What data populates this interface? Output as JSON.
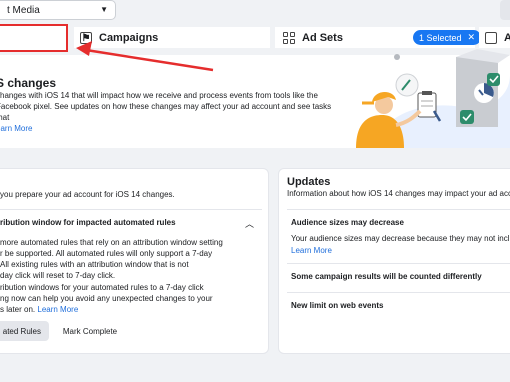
{
  "header": {
    "account_select_value": "t Media"
  },
  "tabs": {
    "campaigns_label": "Campaigns",
    "adsets_label": "Ad Sets",
    "adsets_badge": "1 Selected",
    "ads_label": "Ac"
  },
  "banner": {
    "title": "S changes",
    "body_line1": "changes with iOS 14 that will impact how we receive and process events from tools like the",
    "body_line2": "Facebook pixel. See updates on how these changes may affect your ad account and see tasks that",
    "learn_more": "earn More"
  },
  "tasks_card": {
    "intro": "you prepare your ad account for iOS 14 changes.",
    "heading": "ribution window for impacted automated rules",
    "p1_lines": [
      "more automated rules that rely on an attribution window setting",
      "r be supported. All automated rules will only support a 7-day",
      "All existing rules with an attribution window that is not",
      "day click will reset to 7-day click."
    ],
    "p2_lines": [
      "ribution windows for your automated rules to a 7-day click",
      "ng now can help you avoid any unexpected changes to your",
      "s later on."
    ],
    "p2_learn_more": "Learn More",
    "automated_rules_button": "ated Rules",
    "mark_complete_button": "Mark Complete"
  },
  "updates_card": {
    "title": "Updates",
    "subtitle": "Information about how iOS 14 changes may impact your ad accou",
    "items": [
      {
        "title": "Audience sizes may decrease",
        "body": "Your audience sizes may decrease because they may not includ",
        "link": "Learn More"
      },
      {
        "title": "Some campaign results will be counted differently"
      },
      {
        "title": "New limit on web events"
      }
    ]
  },
  "colors": {
    "accent_blue": "#1877f2",
    "annotation_red": "#e52d2d",
    "link_blue": "#216fdb"
  }
}
